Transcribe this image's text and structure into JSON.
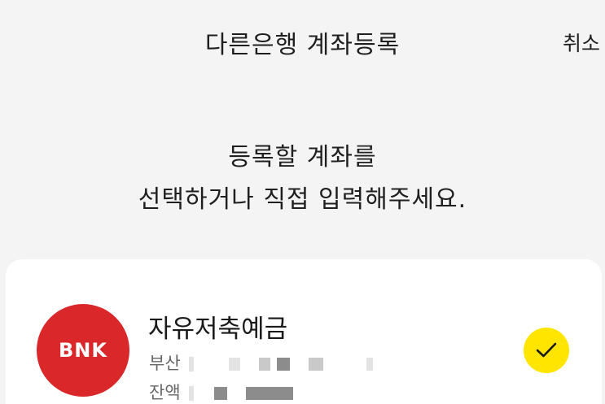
{
  "header": {
    "title": "다른은행 계좌등록",
    "cancel_label": "취소"
  },
  "prompt": {
    "line1": "등록할 계좌를",
    "line2": "선택하거나 직접 입력해주세요."
  },
  "accounts": [
    {
      "bank_logo_text": "BNK",
      "bank_logo_color": "#d9272a",
      "name": "자유저축예금",
      "bank_line_prefix": "부산",
      "balance_line_prefix": "잔액",
      "selected": true,
      "check_color": "#ffe500",
      "check_icon": "check-icon"
    }
  ]
}
